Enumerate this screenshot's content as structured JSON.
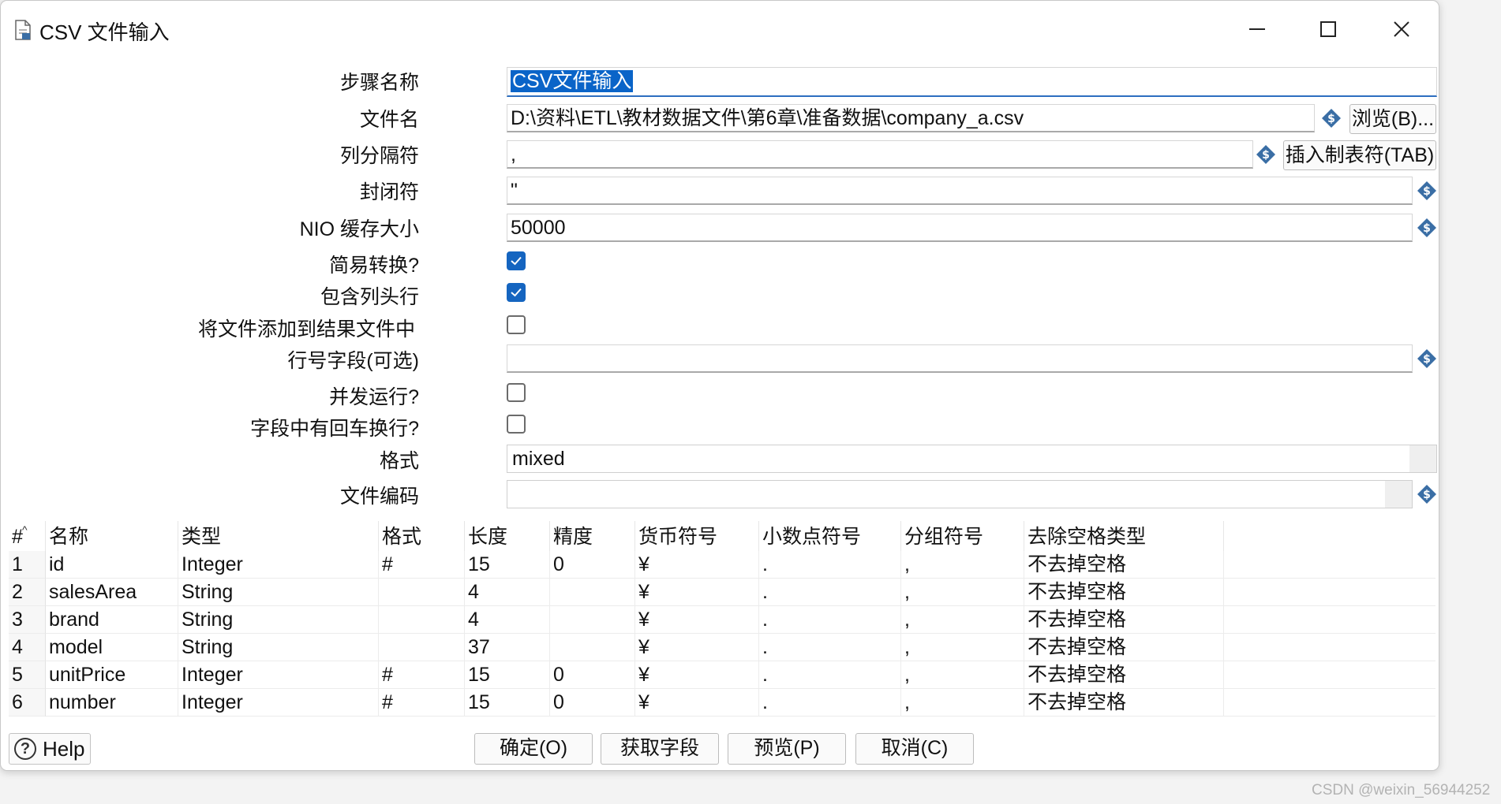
{
  "window": {
    "title": "CSV 文件输入",
    "icon": "document-icon"
  },
  "form": {
    "step_name_label": "步骤名称",
    "step_name_value": "CSV文件输入",
    "filename_label": "文件名",
    "filename_value": "D:\\资料\\ETL\\教材数据文件\\第6章\\准备数据\\company_a.csv",
    "browse_button": "浏览(B)...",
    "delimiter_label": "列分隔符",
    "delimiter_value": ",",
    "insert_tab_button": "插入制表符(TAB)",
    "enclosure_label": "封闭符",
    "enclosure_value": "\"",
    "nio_label": "NIO 缓存大小",
    "nio_value": "50000",
    "lazy_label": "简易转换?",
    "lazy_checked": true,
    "header_label": "包含列头行",
    "header_checked": true,
    "add_result_label": "将文件添加到结果文件中",
    "add_result_checked": false,
    "rownum_label": "行号字段(可选)",
    "rownum_value": "",
    "parallel_label": "并发运行?",
    "parallel_checked": false,
    "newline_label": "字段中有回车换行?",
    "newline_checked": false,
    "format_label": "格式",
    "format_value": "mixed",
    "encoding_label": "文件编码",
    "encoding_value": ""
  },
  "table": {
    "columns": [
      "#",
      "名称",
      "类型",
      "格式",
      "长度",
      "精度",
      "货币符号",
      "小数点符号",
      "分组符号",
      "去除空格类型",
      ""
    ],
    "rows": [
      [
        "1",
        "id",
        "Integer",
        "#",
        "15",
        "0",
        "¥",
        ".",
        ",",
        "不去掉空格",
        ""
      ],
      [
        "2",
        "salesArea",
        "String",
        "",
        "4",
        "",
        "¥",
        ".",
        ",",
        "不去掉空格",
        ""
      ],
      [
        "3",
        "brand",
        "String",
        "",
        "4",
        "",
        "¥",
        ".",
        ",",
        "不去掉空格",
        ""
      ],
      [
        "4",
        "model",
        "String",
        "",
        "37",
        "",
        "¥",
        ".",
        ",",
        "不去掉空格",
        ""
      ],
      [
        "5",
        "unitPrice",
        "Integer",
        "#",
        "15",
        "0",
        "¥",
        ".",
        ",",
        "不去掉空格",
        ""
      ],
      [
        "6",
        "number",
        "Integer",
        "#",
        "15",
        "0",
        "¥",
        ".",
        ",",
        "不去掉空格",
        ""
      ]
    ]
  },
  "buttons": {
    "help": "Help",
    "ok": "确定(O)",
    "get_fields": "获取字段",
    "preview": "预览(P)",
    "cancel": "取消(C)"
  },
  "watermark": "CSDN @weixin_56944252",
  "colors": {
    "accent": "#0a64c8",
    "checkbox_checked": "#1565c0",
    "variable_icon": "#3a6ea5"
  }
}
